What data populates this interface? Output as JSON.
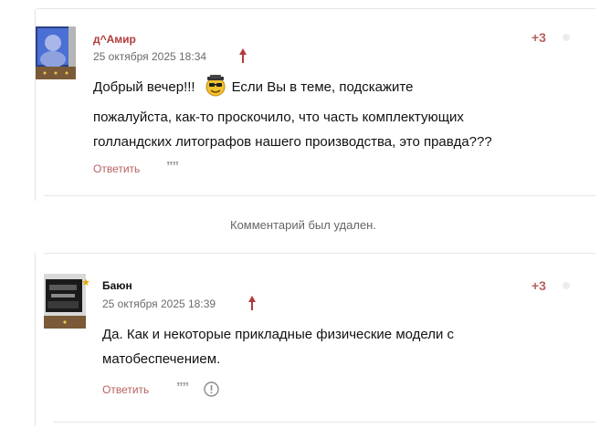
{
  "comments": [
    {
      "author": "д^Амир",
      "date": "25 октября 2025 18:34",
      "score": "+3",
      "lines": [
        "Добрый вечер!!!",
        "пожалуйста, как-то проскочило, что часть комплектующих",
        "голландских литографов нашего производства, это правда???"
      ],
      "line1_rest": "Если Вы в теме, подскажите",
      "reply_label": "Ответить",
      "quote_glyph": "””"
    },
    {
      "author": "Баюн",
      "date": "25 октября 2025 18:39",
      "score": "+3",
      "lines": [
        "Да. Как и некоторые прикладные физические модели с",
        "матобеспечением."
      ],
      "reply_label": "Ответить",
      "quote_glyph": "””"
    }
  ],
  "deleted_notice": "Комментарий был удален.",
  "colors": {
    "accent": "#b86060",
    "meta": "#6b6b6b",
    "divider": "#e6e6e6"
  },
  "icons": [
    "sunglasses-smiley-icon",
    "arrow-up-icon",
    "quote-icon",
    "report-icon",
    "star-icon"
  ]
}
